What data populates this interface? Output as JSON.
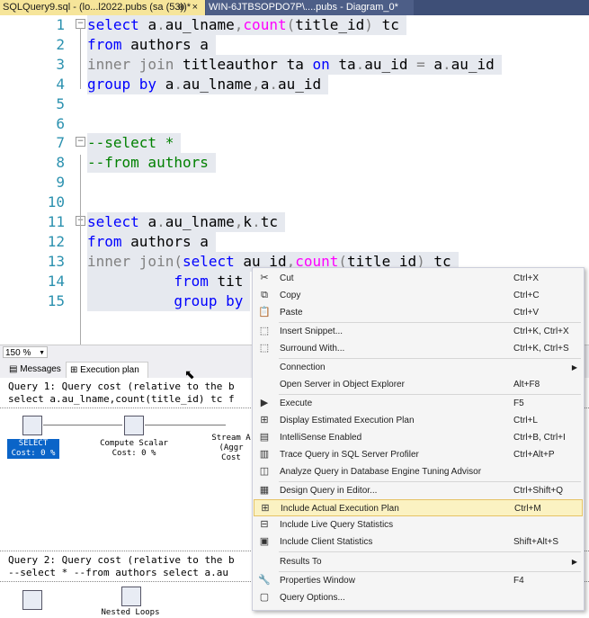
{
  "tabs": [
    {
      "label": "SQLQuery9.sql - (lo...l2022.pubs (sa (53))*",
      "pin": "⊕",
      "close": "×"
    },
    {
      "label": "WIN-6JTBSOPDO7P\\....pubs - Diagram_0*"
    }
  ],
  "editor": {
    "line_numbers": [
      "1",
      "2",
      "3",
      "4",
      "5",
      "6",
      "7",
      "8",
      "9",
      "10",
      "11",
      "12",
      "13",
      "14",
      "15"
    ],
    "lines": [
      [
        {
          "t": "select ",
          "c": "kw"
        },
        {
          "t": "a",
          "c": "id"
        },
        {
          "t": ".",
          "c": "gr"
        },
        {
          "t": "au_lname",
          "c": "id"
        },
        {
          "t": ",",
          "c": "gr"
        },
        {
          "t": "count",
          "c": "fn"
        },
        {
          "t": "(",
          "c": "gr"
        },
        {
          "t": "title_id",
          "c": "id"
        },
        {
          "t": ")",
          "c": "gr"
        },
        {
          "t": " tc",
          "c": "id"
        }
      ],
      [
        {
          "t": "from ",
          "c": "kw"
        },
        {
          "t": "authors a",
          "c": "id"
        }
      ],
      [
        {
          "t": "inner join ",
          "c": "gr"
        },
        {
          "t": "titleauthor ta ",
          "c": "id"
        },
        {
          "t": "on ",
          "c": "kw"
        },
        {
          "t": "ta",
          "c": "id"
        },
        {
          "t": ".",
          "c": "gr"
        },
        {
          "t": "au_id ",
          "c": "id"
        },
        {
          "t": "= ",
          "c": "gr"
        },
        {
          "t": "a",
          "c": "id"
        },
        {
          "t": ".",
          "c": "gr"
        },
        {
          "t": "au_id",
          "c": "id"
        }
      ],
      [
        {
          "t": "group by ",
          "c": "kw"
        },
        {
          "t": "a",
          "c": "id"
        },
        {
          "t": ".",
          "c": "gr"
        },
        {
          "t": "au_lname",
          "c": "id"
        },
        {
          "t": ",",
          "c": "gr"
        },
        {
          "t": "a",
          "c": "id"
        },
        {
          "t": ".",
          "c": "gr"
        },
        {
          "t": "au_id",
          "c": "id"
        }
      ],
      [],
      [],
      [
        {
          "t": "--select *",
          "c": "cm"
        }
      ],
      [
        {
          "t": "--from authors",
          "c": "cm"
        }
      ],
      [],
      [],
      [
        {
          "t": "select ",
          "c": "kw"
        },
        {
          "t": "a",
          "c": "id"
        },
        {
          "t": ".",
          "c": "gr"
        },
        {
          "t": "au_lname",
          "c": "id"
        },
        {
          "t": ",",
          "c": "gr"
        },
        {
          "t": "k",
          "c": "id"
        },
        {
          "t": ".",
          "c": "gr"
        },
        {
          "t": "tc",
          "c": "id"
        }
      ],
      [
        {
          "t": "from ",
          "c": "kw"
        },
        {
          "t": "authors a",
          "c": "id"
        }
      ],
      [
        {
          "t": "inner join",
          "c": "gr"
        },
        {
          "t": "(",
          "c": "gr"
        },
        {
          "t": "select ",
          "c": "kw"
        },
        {
          "t": "au_id",
          "c": "id"
        },
        {
          "t": ",",
          "c": "gr"
        },
        {
          "t": "count",
          "c": "fn"
        },
        {
          "t": "(",
          "c": "gr"
        },
        {
          "t": "title_id",
          "c": "id"
        },
        {
          "t": ") ",
          "c": "gr"
        },
        {
          "t": "tc",
          "c": "id"
        }
      ],
      [
        {
          "t": "          from ",
          "c": "kw"
        },
        {
          "t": "tit",
          "c": "id"
        }
      ],
      [
        {
          "t": "          group by",
          "c": "kw"
        }
      ]
    ]
  },
  "zoom": "150 %",
  "results_tabs": {
    "messages": "Messages",
    "plan": "Execution plan"
  },
  "plan": {
    "q1_header": "Query 1: Query cost (relative to the b",
    "q1_sql": "select a.au_lname,count(title_id) tc f",
    "ops1": [
      {
        "label": "SELECT\nCost: 0 %"
      },
      {
        "label": "Compute Scalar\nCost: 0 %"
      },
      {
        "label": "Stream A\n(Aggr\nCost"
      }
    ],
    "q2_header": "Query 2: Query cost (relative to the b",
    "q2_sql": "--select * --from authors select a.au",
    "ops2": [
      {
        "label": ""
      },
      {
        "label": "Nested Loops"
      }
    ]
  },
  "menu": {
    "items": [
      {
        "icon": "✂",
        "name": "cut",
        "label": "Cut",
        "shortcut": "Ctrl+X"
      },
      {
        "icon": "⧉",
        "name": "copy",
        "label": "Copy",
        "shortcut": "Ctrl+C"
      },
      {
        "icon": "📋",
        "name": "paste",
        "label": "Paste",
        "shortcut": "Ctrl+V"
      },
      {
        "sep": true
      },
      {
        "icon": "⬚",
        "name": "insert-snippet",
        "label": "Insert Snippet...",
        "shortcut": "Ctrl+K, Ctrl+X"
      },
      {
        "icon": "⬚",
        "name": "surround-with",
        "label": "Surround With...",
        "shortcut": "Ctrl+K, Ctrl+S"
      },
      {
        "sep": true
      },
      {
        "icon": "",
        "name": "connection",
        "label": "Connection",
        "shortcut": "",
        "sub": true
      },
      {
        "icon": "",
        "name": "open-server",
        "label": "Open Server in Object Explorer",
        "shortcut": "Alt+F8"
      },
      {
        "sep": true
      },
      {
        "icon": "▶",
        "name": "execute",
        "label": "Execute",
        "shortcut": "F5"
      },
      {
        "icon": "⊞",
        "name": "display-estimated-plan",
        "label": "Display Estimated Execution Plan",
        "shortcut": "Ctrl+L"
      },
      {
        "icon": "▤",
        "name": "intellisense",
        "label": "IntelliSense Enabled",
        "shortcut": "Ctrl+B, Ctrl+I"
      },
      {
        "icon": "▥",
        "name": "trace-query",
        "label": "Trace Query in SQL Server Profiler",
        "shortcut": "Ctrl+Alt+P"
      },
      {
        "icon": "◫",
        "name": "analyze-query",
        "label": "Analyze Query in Database Engine Tuning Advisor",
        "shortcut": ""
      },
      {
        "sep": true
      },
      {
        "icon": "▦",
        "name": "design-query",
        "label": "Design Query in Editor...",
        "shortcut": "Ctrl+Shift+Q"
      },
      {
        "icon": "⊞",
        "name": "include-actual-plan",
        "label": "Include Actual Execution Plan",
        "shortcut": "Ctrl+M",
        "hl": true
      },
      {
        "icon": "⊟",
        "name": "live-query-stats",
        "label": "Include Live Query Statistics",
        "shortcut": ""
      },
      {
        "icon": "▣",
        "name": "client-stats",
        "label": "Include Client Statistics",
        "shortcut": "Shift+Alt+S"
      },
      {
        "sep": true
      },
      {
        "icon": "",
        "name": "results-to",
        "label": "Results To",
        "shortcut": "",
        "sub": true
      },
      {
        "sep": true
      },
      {
        "icon": "🔧",
        "name": "properties-window",
        "label": "Properties Window",
        "shortcut": "F4"
      },
      {
        "icon": "▢",
        "name": "query-options",
        "label": "Query Options...",
        "shortcut": ""
      }
    ]
  }
}
